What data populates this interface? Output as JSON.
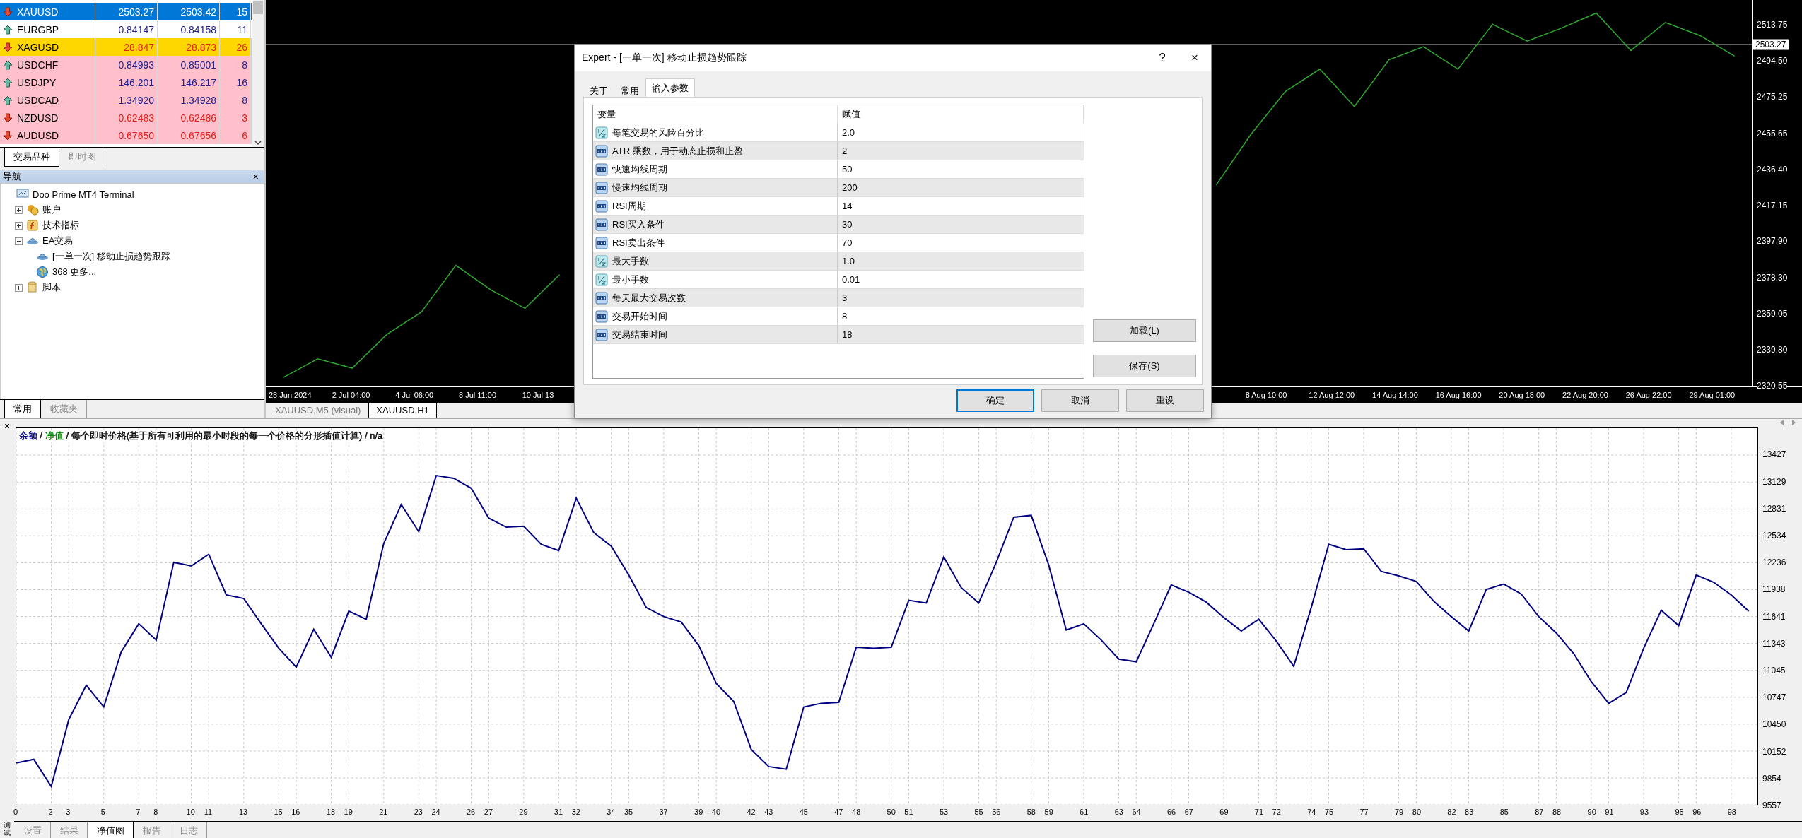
{
  "market_watch": {
    "rows": [
      {
        "symbol": "XAUUSD",
        "bid": "2503.27",
        "ask": "2503.42",
        "spread": "15",
        "down": true,
        "selected": true
      },
      {
        "symbol": "EURGBP",
        "bid": "0.84147",
        "ask": "0.84158",
        "spread": "11",
        "down": false,
        "selected": false,
        "color": "#ffffff"
      },
      {
        "symbol": "XAGUSD",
        "bid": "28.847",
        "ask": "28.873",
        "spread": "26",
        "down": true,
        "selected": false,
        "color": "#ffd700"
      },
      {
        "symbol": "USDCHF",
        "bid": "0.84993",
        "ask": "0.85001",
        "spread": "8",
        "down": false,
        "selected": false,
        "color": "#ffc0cb"
      },
      {
        "symbol": "USDJPY",
        "bid": "146.201",
        "ask": "146.217",
        "spread": "16",
        "down": false,
        "selected": false,
        "color": "#ffc0cb"
      },
      {
        "symbol": "USDCAD",
        "bid": "1.34920",
        "ask": "1.34928",
        "spread": "8",
        "down": false,
        "selected": false,
        "color": "#ffc0cb"
      },
      {
        "symbol": "NZDUSD",
        "bid": "0.62483",
        "ask": "0.62486",
        "spread": "3",
        "down": true,
        "selected": false,
        "color": "#ffc0cb"
      },
      {
        "symbol": "AUDUSD",
        "bid": "0.67650",
        "ask": "0.67656",
        "spread": "6",
        "down": true,
        "selected": false,
        "color": "#ffc0cb"
      }
    ],
    "tabs": [
      {
        "label": "交易品种",
        "selected": true
      },
      {
        "label": "即时图",
        "selected": false
      }
    ]
  },
  "navigator": {
    "title": "导航",
    "close": "×",
    "tree": [
      {
        "label": "Doo Prime MT4 Terminal",
        "kind": "terminal",
        "children": [
          {
            "label": "账户",
            "kind": "accounts",
            "expanded": false
          },
          {
            "label": "技术指标",
            "kind": "indicators",
            "expanded": false
          },
          {
            "label": "EA交易",
            "kind": "experts",
            "expanded": true,
            "children": [
              {
                "label": "[一单一次] 移动止损趋势跟踪",
                "kind": "expert"
              },
              {
                "label": "368 更多...",
                "kind": "more"
              }
            ]
          },
          {
            "label": "脚本",
            "kind": "scripts",
            "expanded": false
          }
        ]
      }
    ],
    "tabs": [
      {
        "label": "常用",
        "selected": true
      },
      {
        "label": "收藏夹",
        "selected": false
      }
    ]
  },
  "price_chart": {
    "chart_data": {
      "type": "line",
      "ylim": [
        2320.2,
        2527.0
      ],
      "ref_lines": [
        {
          "axis": "y",
          "value": 2503.27
        }
      ],
      "yticks": [
        {
          "value": 2513.75,
          "label": "2513.75"
        },
        {
          "value": 2494.5,
          "label": "2494.50"
        },
        {
          "value": 2475.25,
          "label": "2475.25"
        },
        {
          "value": 2455.65,
          "label": "2455.65"
        },
        {
          "value": 2436.4,
          "label": "2436.40"
        },
        {
          "value": 2417.15,
          "label": "2417.15"
        },
        {
          "value": 2397.9,
          "label": "2397.90"
        },
        {
          "value": 2378.3,
          "label": "2378.30"
        },
        {
          "value": 2359.05,
          "label": "2359.05"
        },
        {
          "value": 2339.8,
          "label": "2339.80"
        },
        {
          "value": 2320.55,
          "label": "2320.55"
        }
      ],
      "series": [
        {
          "color": "#2fa82f",
          "values": [
            2325,
            2335,
            2330,
            2348,
            2360,
            2385,
            2372,
            2362,
            2380,
            null,
            null,
            null,
            null,
            null,
            null,
            null,
            null,
            null,
            null,
            null,
            null,
            null,
            null,
            null,
            null,
            null,
            null,
            2428,
            2455,
            2478,
            2490,
            2470,
            2495,
            2502,
            2490,
            2514,
            2505,
            2512,
            2520,
            2500,
            2515,
            2508,
            2497
          ]
        }
      ]
    },
    "current_price": "2503.27",
    "time_axis_left": [
      "28 Jun 2024",
      "2 Jul 04:00",
      "4 Jul 06:00",
      "8 Jul 11:00",
      "10 Jul 13"
    ],
    "time_axis_right": [
      "8 Aug 10:00",
      "12 Aug 12:00",
      "14 Aug 14:00",
      "16 Aug 16:00",
      "20 Aug 18:00",
      "22 Aug 20:00",
      "26 Aug 22:00",
      "29 Aug 01:00"
    ],
    "tabs": [
      {
        "label": "XAUUSD,M5 (visual)",
        "selected": false
      },
      {
        "label": "XAUUSD,H1",
        "selected": true
      }
    ]
  },
  "dialog": {
    "title": "Expert - [一单一次] 移动止损趋势跟踪",
    "help": "?",
    "close": "×",
    "tabs": [
      {
        "label": "关于",
        "selected": false
      },
      {
        "label": "常用",
        "selected": false
      },
      {
        "label": "输入参数",
        "selected": true
      }
    ],
    "columns": [
      "变量",
      "赋值"
    ],
    "params": [
      {
        "kind": "double",
        "name": "每笔交易的风险百分比",
        "value": "2.0"
      },
      {
        "kind": "int",
        "name": "ATR 乘数，用于动态止损和止盈",
        "value": "2"
      },
      {
        "kind": "int",
        "name": "快速均线周期",
        "value": "50"
      },
      {
        "kind": "int",
        "name": "慢速均线周期",
        "value": "200"
      },
      {
        "kind": "int",
        "name": "RSI周期",
        "value": "14"
      },
      {
        "kind": "int",
        "name": "RSI买入条件",
        "value": "30"
      },
      {
        "kind": "int",
        "name": "RSI卖出条件",
        "value": "70"
      },
      {
        "kind": "double",
        "name": "最大手数",
        "value": "1.0"
      },
      {
        "kind": "double",
        "name": "最小手数",
        "value": "0.01"
      },
      {
        "kind": "int",
        "name": "每天最大交易次数",
        "value": "3"
      },
      {
        "kind": "int",
        "name": "交易开始时间",
        "value": "8"
      },
      {
        "kind": "int",
        "name": "交易结束时间",
        "value": "18"
      }
    ],
    "side_buttons": [
      "加载(L)",
      "保存(S)"
    ],
    "buttons": [
      {
        "label": "确定",
        "default": true
      },
      {
        "label": "取消",
        "default": false
      },
      {
        "label": "重设",
        "default": false
      }
    ]
  },
  "tester": {
    "close": "×",
    "side_label": "测试",
    "header": [
      {
        "text": "余额",
        "color": "#000080"
      },
      {
        "text": " / "
      },
      {
        "text": "净值",
        "color": "#008000"
      },
      {
        "text": " / 每个即时价格(基于所有可利用的最小时段的每一个价格的分形插值计算) / n/a"
      }
    ],
    "chart_data": {
      "type": "line",
      "grid": true,
      "xlim": [
        0,
        99.5
      ],
      "ylim": [
        9557,
        13725
      ],
      "x": [
        0,
        1,
        2,
        3,
        4,
        5,
        6,
        7,
        8,
        9,
        10,
        11,
        12,
        13,
        14,
        15,
        16,
        17,
        18,
        19,
        20,
        21,
        22,
        23,
        24,
        25,
        26,
        27,
        28,
        29,
        30,
        31,
        32,
        33,
        34,
        35,
        36,
        37,
        38,
        39,
        40,
        41,
        42,
        43,
        44,
        45,
        46,
        47,
        48,
        49,
        50,
        51,
        52,
        53,
        54,
        55,
        56,
        57,
        58,
        59,
        60,
        61,
        62,
        63,
        64,
        65,
        66,
        67,
        68,
        69,
        70,
        71,
        72,
        73,
        74,
        75,
        76,
        77,
        78,
        79,
        80,
        81,
        82,
        83,
        84,
        85,
        86,
        87,
        88,
        89,
        90,
        91,
        92,
        93,
        94,
        95,
        96,
        97,
        98,
        99
      ],
      "xticks": [
        0,
        2,
        3,
        5,
        7,
        8,
        10,
        11,
        13,
        15,
        16,
        18,
        19,
        21,
        23,
        24,
        26,
        27,
        29,
        31,
        32,
        34,
        35,
        37,
        39,
        40,
        42,
        43,
        45,
        47,
        48,
        50,
        51,
        53,
        55,
        56,
        58,
        59,
        61,
        63,
        64,
        66,
        67,
        69,
        71,
        72,
        74,
        75,
        77,
        79,
        80,
        82,
        83,
        85,
        87,
        88,
        90,
        91,
        93,
        95,
        96,
        98
      ],
      "yticks": [
        9557,
        9854,
        10152,
        10450,
        10747,
        11045,
        11343,
        11641,
        11938,
        12236,
        12534,
        12831,
        13129,
        13427
      ],
      "series": [
        {
          "color": "#000080",
          "values": [
            10020,
            10060,
            9760,
            10500,
            10880,
            10640,
            11250,
            11560,
            11380,
            12240,
            12200,
            12330,
            11880,
            11840,
            11560,
            11290,
            11080,
            11500,
            11190,
            11700,
            11610,
            12450,
            12880,
            12580,
            13200,
            13170,
            13060,
            12730,
            12630,
            12640,
            12440,
            12370,
            12950,
            12570,
            12420,
            12100,
            11740,
            11640,
            11580,
            11320,
            10900,
            10700,
            10170,
            9980,
            9950,
            10640,
            10680,
            10690,
            11300,
            11290,
            11300,
            11820,
            11790,
            12300,
            11960,
            11790,
            12240,
            12740,
            12760,
            12210,
            11490,
            11560,
            11380,
            11170,
            11140,
            11560,
            11990,
            11910,
            11800,
            11630,
            11480,
            11610,
            11370,
            11090,
            11740,
            12440,
            12380,
            12390,
            12140,
            12090,
            12030,
            11810,
            11640,
            11480,
            11940,
            12000,
            11890,
            11640,
            11460,
            11230,
            10920,
            10680,
            10800,
            11290,
            11710,
            11540,
            12100,
            12020,
            11880,
            11700
          ]
        }
      ]
    },
    "tabs": [
      {
        "label": "设置",
        "selected": false
      },
      {
        "label": "结果",
        "selected": false
      },
      {
        "label": "净值图",
        "selected": true
      },
      {
        "label": "报告",
        "selected": false
      },
      {
        "label": "日志",
        "selected": false
      }
    ]
  }
}
